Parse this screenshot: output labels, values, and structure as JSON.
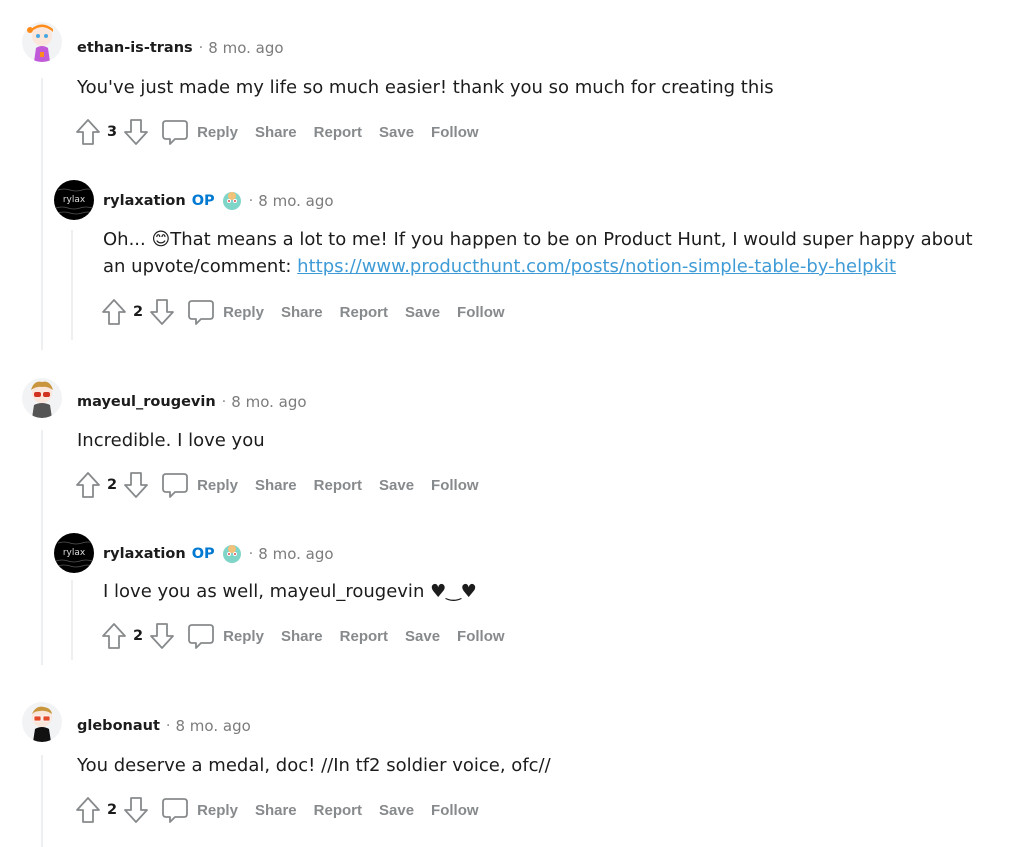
{
  "actions": {
    "reply": "Reply",
    "share": "Share",
    "report": "Report",
    "save": "Save",
    "follow": "Follow"
  },
  "colors": {
    "op_badge": "#0079d3",
    "link": "#3f9bd6",
    "action_text": "#878a8c",
    "thread_line": "#edeff1"
  },
  "comments": [
    {
      "username": "ethan-is-trans",
      "time": "8 mo. ago",
      "body": "You've just made my life so much easier! thank you so much for creating this",
      "score": "3",
      "avatar": "snoo-avatar-orange-bow"
    },
    {
      "username": "rylaxation",
      "op_label": "OP",
      "flair": "snoo-flair-icon",
      "time": "8 mo. ago",
      "body_line1_prefix": "Oh... ",
      "body_emoji": "😊",
      "body_line1_rest": "That means a lot to me! If you happen to be on Product Hunt, I would super happy about",
      "body_line2_prefix": "an upvote/comment: ",
      "link_text": "https://www.producthunt.com/posts/notion-simple-table-by-helpkit",
      "score": "2",
      "avatar_text": "rylax"
    },
    {
      "username": "mayeul_rougevin",
      "time": "8 mo. ago",
      "body": "Incredible. I love you",
      "score": "2",
      "avatar": "snoo-avatar-sunglasses"
    },
    {
      "username": "rylaxation",
      "op_label": "OP",
      "flair": "snoo-flair-icon",
      "time": "8 mo. ago",
      "body": "I love you as well, mayeul_rougevin ♥‿♥",
      "score": "2",
      "avatar_text": "rylax"
    },
    {
      "username": "glebonaut",
      "time": "8 mo. ago",
      "body": "You deserve a medal, doc! //In tf2 soldier voice, ofc//",
      "score": "2",
      "avatar": "snoo-avatar-glasses"
    }
  ],
  "separator": "·"
}
